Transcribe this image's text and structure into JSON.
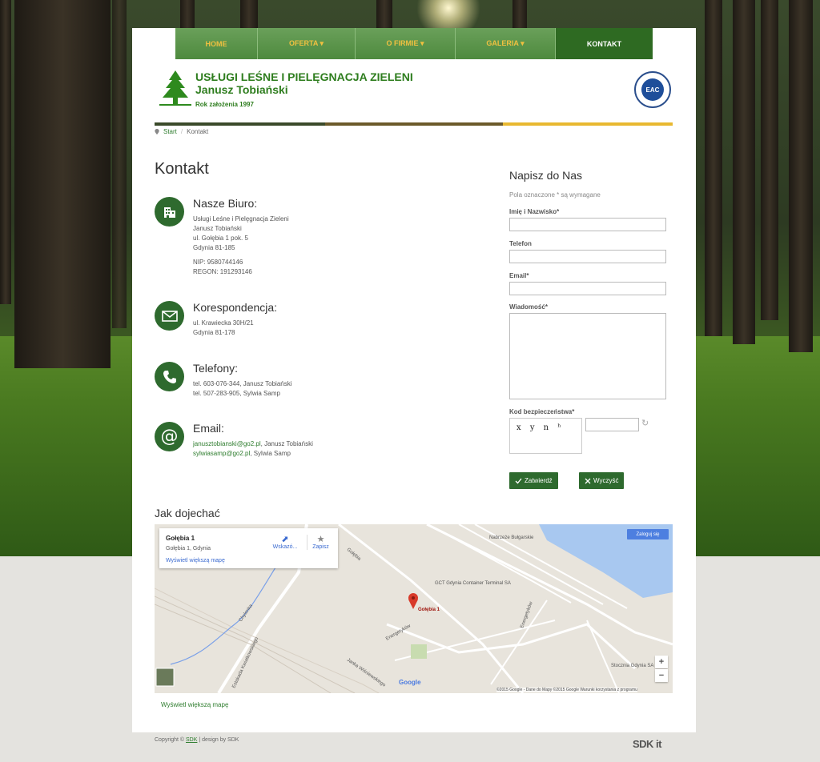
{
  "nav": {
    "items": [
      {
        "label": "HOME"
      },
      {
        "label": "OFERTA ▾"
      },
      {
        "label": "O FIRMIE ▾"
      },
      {
        "label": "GALERIA ▾"
      },
      {
        "label": "KONTAKT"
      }
    ]
  },
  "header": {
    "title": "USŁUGI LEŚNE I PIELĘGNACJA ZIELENI",
    "owner": "Janusz Tobiański",
    "founded": "Rok założenia 1997",
    "badge": "EAC"
  },
  "breadcrumb": {
    "home": "Start",
    "sep": "/",
    "current": "Kontakt"
  },
  "page_title": "Kontakt",
  "office": {
    "title": "Nasze Biuro:",
    "lines": [
      "Usługi Leśne i Pielęgnacja Zieleni",
      "Janusz Tobiański",
      "ul. Gołębia 1 pok. 5",
      "Gdynia 81-185"
    ],
    "nip": "NIP: 9580744146",
    "regon": "REGON: 191293146"
  },
  "correspondence": {
    "title": "Korespondencja:",
    "lines": [
      "ul. Krawiecka 30H/21",
      "Gdynia 81-178"
    ]
  },
  "phones": {
    "title": "Telefony:",
    "lines": [
      "tel. 603-076-344, Janusz Tobiański",
      "tel. 507-283-905, Sylwia Samp"
    ]
  },
  "email": {
    "title": "Email:",
    "entries": [
      {
        "address": "janusztobianski@go2.pl",
        "name": ", Janusz Tobiański"
      },
      {
        "address": "sylwiasamp@go2.pl",
        "name": ", Sylwia Samp"
      }
    ]
  },
  "form": {
    "title": "Napisz do Nas",
    "note": "Pola oznaczone * są wymagane",
    "name_label": "Imię i Nazwisko*",
    "phone_label": "Telefon",
    "email_label": "Email*",
    "message_label": "Wiadomość*",
    "captcha_label": "Kod bezpieczeństwa*",
    "captcha_text": "x y n ʰ",
    "submit": "Zatwierdź",
    "clear": "Wyczyść"
  },
  "map": {
    "title": "Jak dojechać",
    "card_title": "Gołębia 1",
    "card_address": "Gołębia 1, Gdynia",
    "card_link": "Wyświetl większą mapę",
    "directions": "Wskazó...",
    "save": "Zapisz",
    "signin": "Zaloguj się",
    "marker_label": "Gołębia 1",
    "labels": {
      "nabrzeze": "Nabrzeże Bułgarskie",
      "golebia": "Gołębia",
      "terminal": "GCT Gdynia Container Terminal SA",
      "energetykow": "Energetyków",
      "chylonka": "Chylonka",
      "kwiatkowskiego": "Estakada Kwiatkowskiego",
      "janka": "Janka Wiśniewskiego",
      "stocznia": "Stocznia Gdynia SA"
    },
    "footer": "©2015 Google - Dane do Mapy ©2015 Google    Warunki korzystania z programu",
    "zoom_in": "+",
    "zoom_out": "−",
    "bottom_link": "Wyświetl większą mapę"
  },
  "footer": {
    "copyright_prefix": "Copyright © ",
    "sdk1": "SDK",
    "middle": " | design by SDK",
    "logo": "SDK it"
  },
  "colors": {
    "green_dark": "#2e6a2e",
    "green_brand": "#2e7d1e",
    "nav_gold": "#f0c040",
    "stripe_dark": "#3a4a2a",
    "stripe_brown": "#6b5a2a",
    "stripe_gold": "#e8b830"
  }
}
